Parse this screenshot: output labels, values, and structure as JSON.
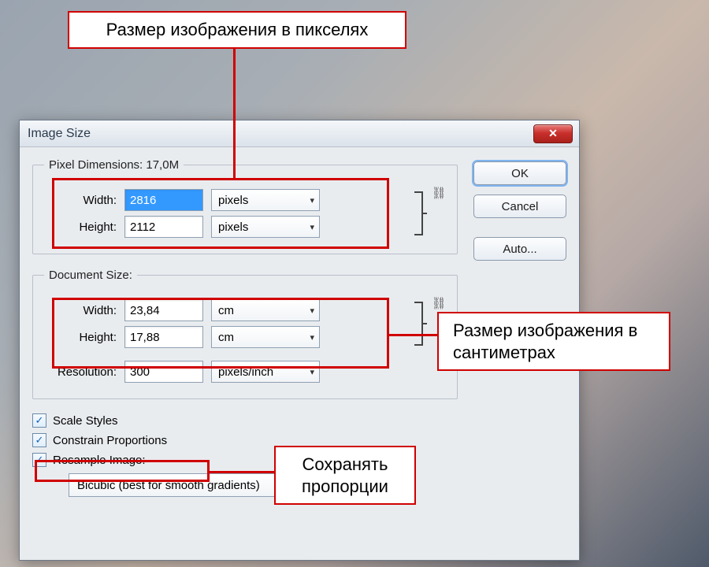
{
  "annotations": {
    "top": "Размер изображения в пикселях",
    "right": "Размер изображения в сантиметрах",
    "bottom": "Сохранять пропорции"
  },
  "dialog": {
    "title": "Image Size",
    "close_glyph": "✕",
    "buttons": {
      "ok": "OK",
      "cancel": "Cancel",
      "auto": "Auto..."
    },
    "pixel_dimensions": {
      "legend": "Pixel Dimensions:  17,0M",
      "width_label": "Width:",
      "width_value": "2816",
      "width_unit": "pixels",
      "height_label": "Height:",
      "height_value": "2112",
      "height_unit": "pixels"
    },
    "document_size": {
      "legend": "Document Size:",
      "width_label": "Width:",
      "width_value": "23,84",
      "width_unit": "cm",
      "height_label": "Height:",
      "height_value": "17,88",
      "height_unit": "cm",
      "resolution_label": "Resolution:",
      "resolution_value": "300",
      "resolution_unit": "pixels/inch"
    },
    "checks": {
      "scale_styles": "Scale Styles",
      "constrain": "Constrain Proportions",
      "resample": "Resample Image:",
      "method": "Bicubic (best for smooth gradients)"
    }
  },
  "glyphs": {
    "checkmark": "✓",
    "chevron_down": "▾",
    "link": "⛓"
  }
}
